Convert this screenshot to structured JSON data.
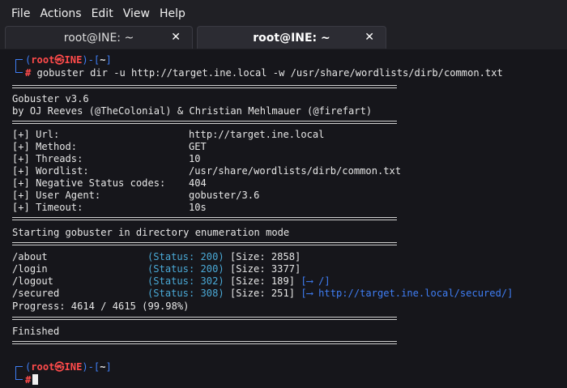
{
  "menubar": {
    "items": [
      "File",
      "Actions",
      "Edit",
      "View",
      "Help"
    ]
  },
  "tabs": [
    {
      "label": "root@INE: ~",
      "active": false
    },
    {
      "label": "root@INE: ~",
      "active": true
    }
  ],
  "icons": {
    "tab_close": "close-icon",
    "kali_skull": "skull-icon"
  },
  "colors": {
    "prompt_blue": "#3f7ef5",
    "prompt_red": "#ff4b4b",
    "status_cyan": "#4aa9d6",
    "background": "#16161b"
  },
  "prompt1": {
    "open": "(",
    "user": "root",
    "skull": "㉿",
    "host": "INE",
    "close_dash": ")-[",
    "dir": "~",
    "close": "]",
    "hash": "#",
    "command": " gobuster dir -u http://target.ine.local -w /usr/share/wordlists/dirb/common.txt"
  },
  "banner": {
    "version": "Gobuster v3.6",
    "authors": "by OJ Reeves (@TheColonial) & Christian Mehlmauer (@firefart)"
  },
  "config": {
    "url_label": "[+] Url:",
    "url_value": "http://target.ine.local",
    "method_label": "[+] Method:",
    "method_value": "GET",
    "threads_label": "[+] Threads:",
    "threads_value": "10",
    "wordlist_label": "[+] Wordlist:",
    "wordlist_value": "/usr/share/wordlists/dirb/common.txt",
    "negstatus_label": "[+] Negative Status codes:",
    "negstatus_value": "404",
    "useragent_label": "[+] User Agent:",
    "useragent_value": "gobuster/3.6",
    "timeout_label": "[+] Timeout:",
    "timeout_value": "10s"
  },
  "start_message": "Starting gobuster in directory enumeration mode",
  "results": [
    {
      "path": "/about",
      "status": "(Status: 200)",
      "size": "[Size: 2858]",
      "redirect": ""
    },
    {
      "path": "/login",
      "status": "(Status: 200)",
      "size": "[Size: 3377]",
      "redirect": ""
    },
    {
      "path": "/logout",
      "status": "(Status: 302)",
      "size": "[Size: 189]",
      "redirect": "[⟶ /]"
    },
    {
      "path": "/secured",
      "status": "(Status: 308)",
      "size": "[Size: 251]",
      "redirect": "[⟶ http://target.ine.local/secured/]"
    }
  ],
  "progress": "Progress: 4614 / 4615 (99.98%)",
  "finished": "Finished",
  "prompt2": {
    "open": "(",
    "user": "root",
    "skull": "㉿",
    "host": "INE",
    "close_dash": ")-[",
    "dir": "~",
    "close": "]",
    "hash": "#"
  }
}
